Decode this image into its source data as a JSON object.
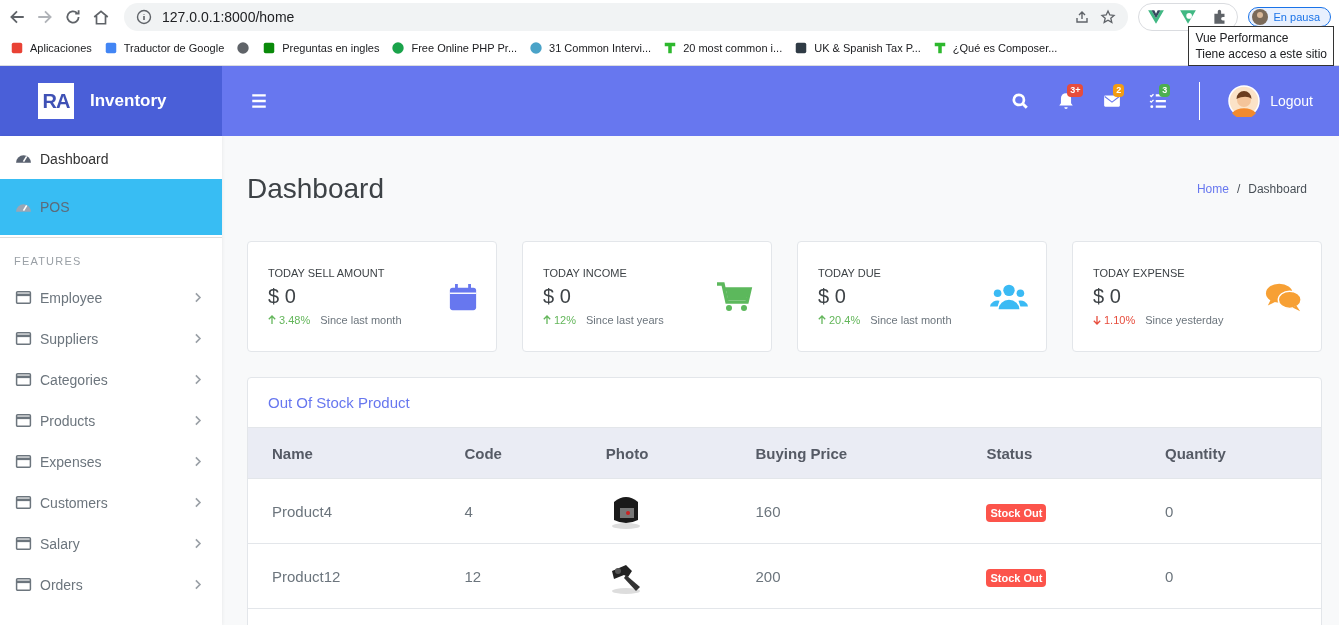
{
  "browser": {
    "address": "127.0.0.1:8000/home",
    "profile": "En pausa",
    "bookmarks": [
      {
        "kind": "labeled",
        "label": "Aplicaciones"
      },
      {
        "kind": "labeled",
        "label": "Traductor de Google"
      },
      {
        "kind": "icon"
      },
      {
        "kind": "labeled",
        "label": "Preguntas en ingles"
      },
      {
        "kind": "labeled",
        "label": "Free Online PHP Pr..."
      },
      {
        "kind": "labeled",
        "label": "31 Common Intervi..."
      },
      {
        "kind": "labeled",
        "label": "20 most common i..."
      },
      {
        "kind": "labeled",
        "label": "UK & Spanish Tax P..."
      },
      {
        "kind": "labeled",
        "label": "¿Qué es Composer..."
      }
    ],
    "tooltip": [
      "Vue Performance",
      "Tiene acceso a este sitio"
    ]
  },
  "brand": {
    "logo": "RA",
    "name": "Inventory"
  },
  "header": {
    "badges": [
      {
        "count": "3+",
        "color": "#e74c3c"
      },
      {
        "count": "2",
        "color": "#f39c12"
      },
      {
        "count": "3",
        "color": "#4caf50"
      }
    ],
    "logout": "Logout"
  },
  "sidebar": {
    "top": [
      {
        "label": "Dashboard",
        "selected": false
      },
      {
        "label": "POS",
        "selected": true
      }
    ],
    "section": "FEATURES",
    "items": [
      {
        "label": "Employee"
      },
      {
        "label": "Suppliers"
      },
      {
        "label": "Categories"
      },
      {
        "label": "Products"
      },
      {
        "label": "Expenses"
      },
      {
        "label": "Customers"
      },
      {
        "label": "Salary"
      },
      {
        "label": "Orders"
      }
    ]
  },
  "page": {
    "title": "Dashboard",
    "breadcrumb": [
      {
        "label": "Home",
        "kind": "link"
      },
      {
        "label": "/",
        "kind": "separator"
      },
      {
        "label": "Dashboard",
        "kind": "current"
      }
    ]
  },
  "cards": [
    {
      "title": "TODAY SELL AMOUNT",
      "value": "$ 0",
      "change": "3.48%",
      "kind": "up",
      "note": "Since last month"
    },
    {
      "title": "TODAY INCOME",
      "value": "$ 0",
      "change": "12%",
      "kind": "up",
      "note": "Since last years"
    },
    {
      "title": "TODAY DUE",
      "value": "$ 0",
      "change": "20.4%",
      "kind": "up",
      "note": "Since last month"
    },
    {
      "title": "TODAY EXPENSE",
      "value": "$ 0",
      "change": "1.10%",
      "kind": "down",
      "note": "Since yesterday"
    }
  ],
  "table": {
    "title": "Out Of Stock Product",
    "columns": [
      "Name",
      "Code",
      "Photo",
      "Buying Price",
      "Status",
      "Quantity"
    ],
    "rows": [
      {
        "name": "Product4",
        "code": "4",
        "price": "160",
        "status": "Stock Out",
        "quantity": "0"
      },
      {
        "name": "Product12",
        "code": "12",
        "price": "200",
        "status": "Stock Out",
        "quantity": "0"
      }
    ]
  }
}
